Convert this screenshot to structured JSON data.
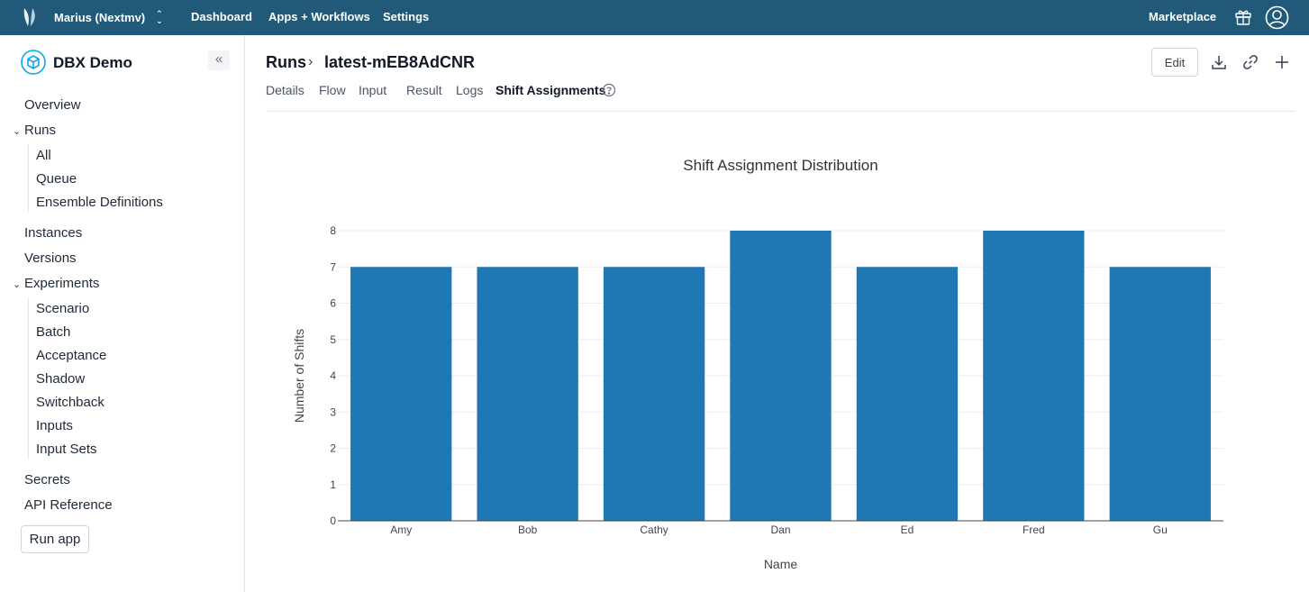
{
  "topbar": {
    "org": "Marius (Nextmv)",
    "nav": [
      "Dashboard",
      "Apps + Workflows",
      "Settings"
    ],
    "marketplace": "Marketplace"
  },
  "sidebar": {
    "app_title": "DBX Demo",
    "collapse_glyph": "«",
    "overview": "Overview",
    "runs": "Runs",
    "runs_children": [
      "All",
      "Queue",
      "Ensemble Definitions"
    ],
    "instances": "Instances",
    "versions": "Versions",
    "experiments": "Experiments",
    "experiments_children": [
      "Scenario",
      "Batch",
      "Acceptance",
      "Shadow",
      "Switchback",
      "Inputs",
      "Input Sets"
    ],
    "secrets": "Secrets",
    "api_reference": "API Reference",
    "run_app": "Run app"
  },
  "header": {
    "breadcrumb_root": "Runs",
    "breadcrumb_sep": "›",
    "run_id": "latest-mEB8AdCNR",
    "edit_label": "Edit"
  },
  "tabs": [
    "Details",
    "Flow",
    "Input",
    "Result",
    "Logs",
    "Shift Assignments"
  ],
  "active_tab": "Shift Assignments",
  "colors": {
    "topbar": "#215a79",
    "bar": "#1f77b4",
    "accent": "#0ea5e9"
  },
  "chart_data": {
    "type": "bar",
    "title": "Shift Assignment Distribution",
    "xlabel": "Name",
    "ylabel": "Number of Shifts",
    "categories": [
      "Amy",
      "Bob",
      "Cathy",
      "Dan",
      "Ed",
      "Fred",
      "Gu"
    ],
    "values": [
      7,
      7,
      7,
      8,
      7,
      8,
      7
    ],
    "ylim": [
      0,
      8
    ],
    "yticks": [
      "0",
      "1",
      "2",
      "3",
      "4",
      "5",
      "6",
      "7",
      "8"
    ],
    "grid": true,
    "legend": "none"
  }
}
